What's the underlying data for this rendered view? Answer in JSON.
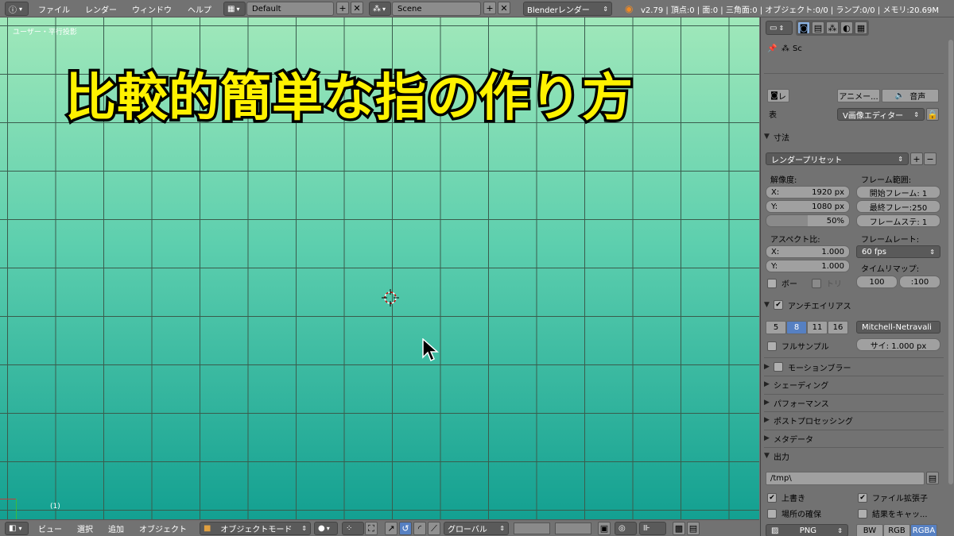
{
  "topbar": {
    "menus": [
      "ファイル",
      "レンダー",
      "ウィンドウ",
      "ヘルプ"
    ],
    "layout_value": "Default",
    "scene_value": "Scene",
    "render_engine": "Blenderレンダー",
    "stats": "v2.79 | 頂点:0 | 面:0 | 三角面:0 | オブジェクト:0/0 | ランプ:0/0 | メモリ:20.69M",
    "add_symbol": "+",
    "close_symbol": "✕"
  },
  "viewport": {
    "label": "ユーザー・平行投影",
    "frame_label": "(1)",
    "overlay_title": "比較的簡単な指の作り方",
    "colors": {
      "top": "#a0e8ba",
      "bottom": "#13a091",
      "title": "#fff200"
    }
  },
  "bottombar": {
    "menus": [
      "ビュー",
      "選択",
      "追加",
      "オブジェクト"
    ],
    "mode": "オブジェクトモード",
    "orientation": "グローバル"
  },
  "props": {
    "scene_path": "Sc",
    "render_btn": "レ",
    "anim_btn": "アニメー...",
    "audio_btn": "音声",
    "display_prefix": "表",
    "display_value": "V画像エディター",
    "dimensions": {
      "title": "寸法",
      "preset": "レンダープリセット",
      "resolution_label": "解像度:",
      "res_x": "X:",
      "res_x_val": "1920 px",
      "res_y": "Y:",
      "res_y_val": "1080 px",
      "res_pct": "50%",
      "frame_range_label": "フレーム範囲:",
      "start": "開始フレーム: 1",
      "end": "最終フレー:250",
      "step": "フレームステ: 1",
      "aspect_label": "アスペクト比:",
      "asp_x": "X:",
      "asp_x_val": "1.000",
      "asp_y": "Y:",
      "asp_y_val": "1.000",
      "framerate_label": "フレームレート:",
      "framerate": "60 fps",
      "remap_label": "タイムリマップ:",
      "remap_old": "100",
      "remap_new": ":100",
      "border": "ボー",
      "crop": "トリ"
    },
    "aa": {
      "title": "アンチエイリアス",
      "samples": [
        "5",
        "8",
        "11",
        "16"
      ],
      "filter": "Mitchell-Netravali",
      "full_sample": "フルサンプル",
      "size": "サイ: 1.000 px"
    },
    "panels": [
      "モーションブラー",
      "シェーディング",
      "パフォーマンス",
      "ポストプロセッシング",
      "メタデータ"
    ],
    "output": {
      "title": "出力",
      "path": "/tmp\\",
      "overwrite": "上書き",
      "file_ext": "ファイル拡張子",
      "placeholders": "場所の確保",
      "cache_result": "結果をキャッ...",
      "format": "PNG",
      "bw": "BW",
      "rgb": "RGB",
      "rgba": "RGBA"
    }
  }
}
